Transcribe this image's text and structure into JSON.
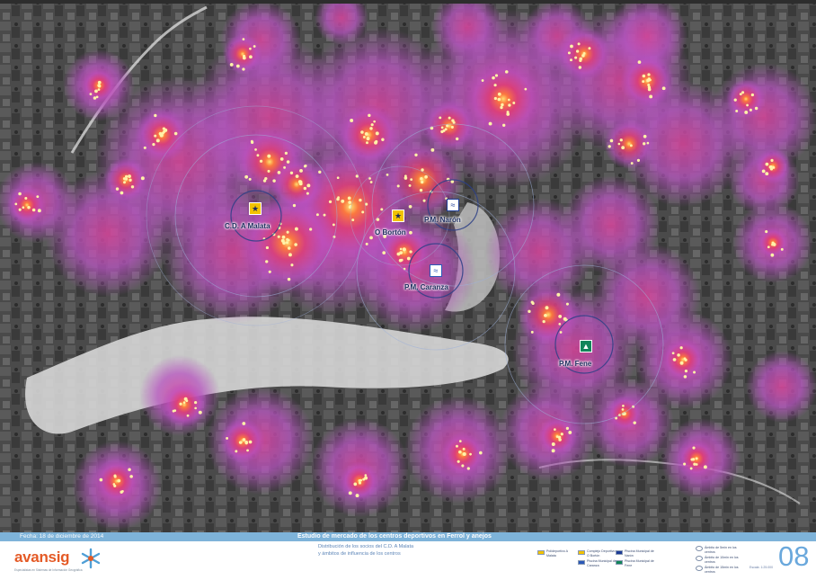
{
  "header": {
    "date": "Fecha: 18 de diciembre de 2014",
    "title": "Estudio de mercado de los centros deportivos en Ferrol y anejos",
    "subtitle_line1": "Distribución de los socios del C.D. A Malata",
    "subtitle_line2": "y ámbitos de influencia de los centros"
  },
  "logo": {
    "name": "avansig",
    "tagline": "Especialistas en Sistemas de Información Geográfica",
    "icon": "snowflake-logo-icon"
  },
  "venues": [
    {
      "label": "C.D. A Malata",
      "icon": "runner-icon",
      "color": "#f2c300"
    },
    {
      "label": "O Bortón",
      "icon": "runner-icon",
      "color": "#f2c300"
    },
    {
      "label": "P.M. Narón",
      "icon": "swimmer-icon",
      "color": "#1d3c96"
    },
    {
      "label": "P.M. Caranza",
      "icon": "swimmer-icon",
      "color": "#2a58b8"
    },
    {
      "label": "P.M. Fene",
      "icon": "pool-icon",
      "color": "#12855a"
    }
  ],
  "legend": {
    "items": [
      {
        "label": "Polideportivo A Malata"
      },
      {
        "label": "Complejo Deportivo O Bortón"
      },
      {
        "label": "Piscina Municipal de Caranza"
      },
      {
        "label": "Piscina Municipal de Narón"
      },
      {
        "label": "Piscina Municipal de Fene"
      }
    ],
    "rings": [
      {
        "label": "Ámbito de 5min en los centros"
      },
      {
        "label": "Ámbito de 10min en los centros"
      },
      {
        "label": "Ámbito de 15min en los centros"
      }
    ],
    "scale": "Escala: 1:25.000"
  },
  "sheet_number": "08",
  "colors": {
    "heat_outer": "#b94fb8",
    "heat_mid": "#e0406a",
    "heat_core": "#ffd23a",
    "footer_bar": "#7eb3d9",
    "accent_orange": "#e45a26",
    "sheet_blue": "#6aa8dc"
  }
}
